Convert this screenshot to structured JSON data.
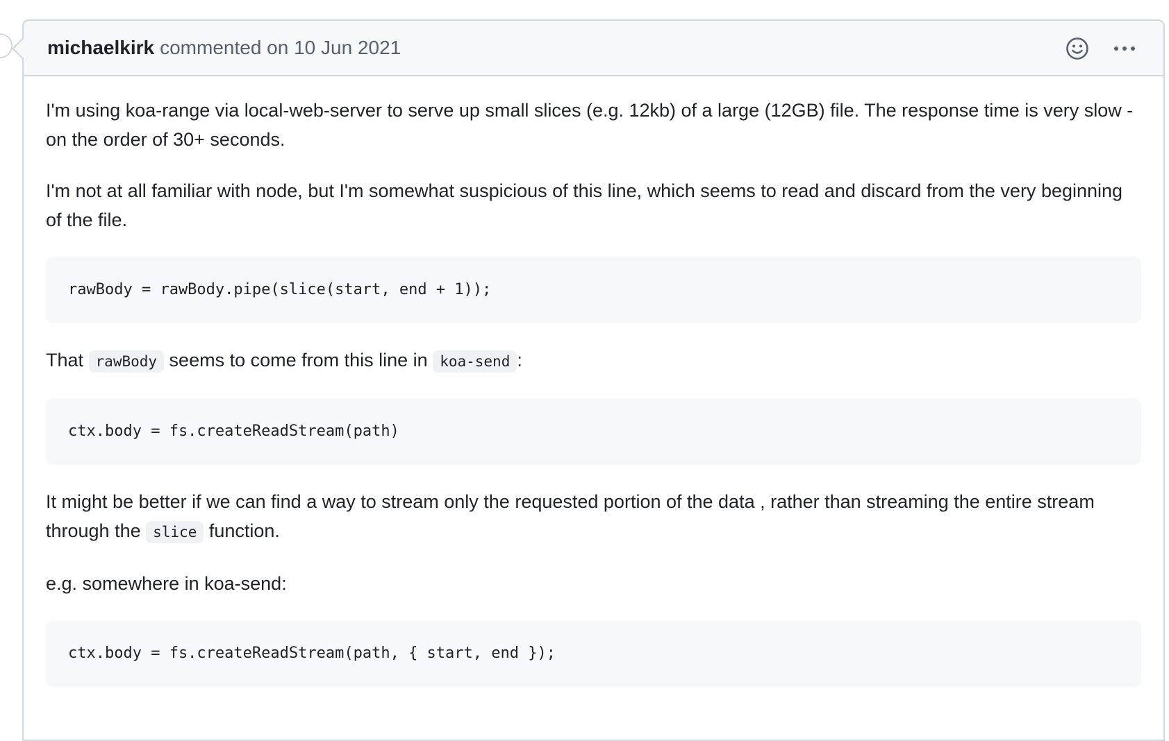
{
  "comment": {
    "author": "michaelkirk",
    "action_text": "commented on 10 Jun 2021",
    "actions": {
      "reaction_icon": "smiley-icon",
      "menu_icon": "kebab-horizontal-icon"
    },
    "body": {
      "p1": "I'm using koa-range via local-web-server to serve up small slices (e.g. 12kb) of a large (12GB) file. The response time is very slow - on the order of 30+ seconds.",
      "p2": "I'm not at all familiar with node, but I'm somewhat suspicious of this line, which seems to read and discard from the very beginning of the file.",
      "code1": "rawBody = rawBody.pipe(slice(start, end + 1));",
      "p3": {
        "t1": "That ",
        "code_a": "rawBody",
        "t2": " seems to come from this line in ",
        "code_b": "koa-send",
        "t3": ":"
      },
      "code2": "ctx.body = fs.createReadStream(path)",
      "p4": {
        "t1": "It might be better if we can find a way to stream only the requested portion of the data , rather than streaming the entire stream through the ",
        "code_a": "slice",
        "t2": " function."
      },
      "p5": "e.g. somewhere in koa-send:",
      "code3": "ctx.body = fs.createReadStream(path, { start, end });"
    }
  },
  "colors": {
    "border": "#d0d7de",
    "header_bg": "#f6f8fa",
    "code_bg": "#f6f8fa",
    "muted_text": "#57606a",
    "text": "#1f2328"
  }
}
